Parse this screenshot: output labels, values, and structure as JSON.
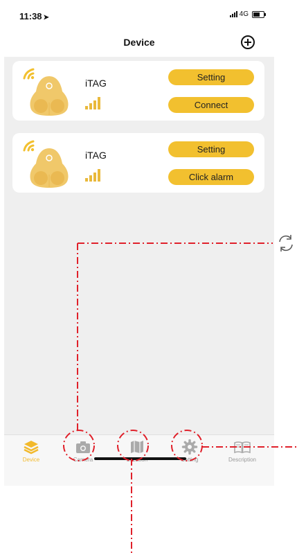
{
  "status_bar": {
    "time": "11:38",
    "network": "4G"
  },
  "header": {
    "title": "Device"
  },
  "devices": [
    {
      "name": "iTAG",
      "primary_label": "Setting",
      "secondary_label": "Connect"
    },
    {
      "name": "iTAG",
      "primary_label": "Setting",
      "secondary_label": "Click alarm"
    }
  ],
  "tabs": [
    {
      "label": "Device",
      "icon": "layers-icon",
      "active": true
    },
    {
      "label": "Camera",
      "icon": "camera-icon",
      "active": false
    },
    {
      "label": "Location",
      "icon": "map-icon",
      "active": false
    },
    {
      "label": "Setting",
      "icon": "gear-icon",
      "active": false
    },
    {
      "label": "Description",
      "icon": "book-icon",
      "active": false
    }
  ],
  "colors": {
    "accent": "#f2c02f",
    "active_tab": "#f2b92b",
    "annotation": "#e0202a",
    "background": "#efefef"
  }
}
